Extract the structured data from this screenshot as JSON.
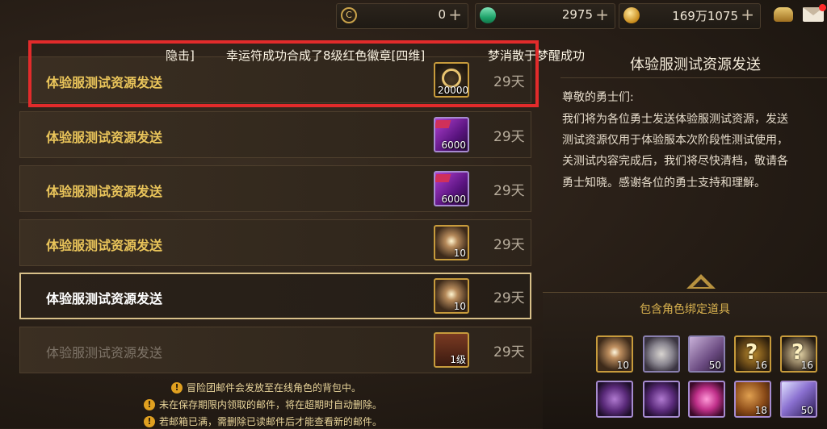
{
  "currency": {
    "c_points": {
      "icon": "c-coin-icon",
      "value": "0"
    },
    "gems": {
      "icon": "green-gem-icon",
      "value": "2975"
    },
    "gold": {
      "icon": "gold-coin-icon",
      "value": "169万1075"
    },
    "plus": "+"
  },
  "ticker": {
    "left_fragment": "隐击]",
    "main": "幸运符成功合成了8级红色徽章[四维]",
    "right_fragment": "梦消散于梦醒成功"
  },
  "mails": [
    {
      "title": "体验服测试资源发送",
      "days": "29天",
      "item_qty": "20000",
      "item": "c-coin-icon"
    },
    {
      "title": "体验服测试资源发送",
      "days": "29天",
      "item_qty": "6000",
      "item": "purple-currency-icon"
    },
    {
      "title": "体验服测试资源发送",
      "days": "29天",
      "item_qty": "6000",
      "item": "purple-currency-icon"
    },
    {
      "title": "体验服测试资源发送",
      "days": "29天",
      "item_qty": "10",
      "item": "starburst-icon"
    },
    {
      "title": "体验服测试资源发送",
      "days": "29天",
      "item_qty": "10",
      "item": "starburst-icon"
    },
    {
      "title": "体验服测试资源发送",
      "days": "29天",
      "item_qty": "1级",
      "item": "monster-card-icon"
    }
  ],
  "detail": {
    "title": "体验服测试资源发送",
    "greeting": "尊敬的勇士们:",
    "lines": [
      "我们将为各位勇士发送体验服测试资源，发送",
      "测试资源仅用于体验服本次阶段性测试使用，",
      "关测试内容完成后，我们将尽快清档，敬请各",
      "勇士知晓。感谢各位的勇士支持和理解。"
    ]
  },
  "items_panel": {
    "header": "包含角色绑定道具",
    "slots": [
      {
        "icon": "starburst-icon",
        "qty": "10"
      },
      {
        "icon": "silver-plate-icon",
        "qty": ""
      },
      {
        "icon": "treasure-box-icon",
        "qty": "50"
      },
      {
        "icon": "mystery-gold-icon",
        "qty": "16"
      },
      {
        "icon": "mystery-silver-icon",
        "qty": "16"
      },
      {
        "icon": "purple-emblem-icon",
        "qty": ""
      },
      {
        "icon": "purple-crown-icon",
        "qty": ""
      },
      {
        "icon": "pink-star-icon",
        "qty": ""
      },
      {
        "icon": "cookie-icon",
        "qty": "18"
      },
      {
        "icon": "crystal-ticket-icon",
        "qty": "50"
      }
    ]
  },
  "notices": [
    "冒险团邮件会发放至在线角色的背包中。",
    "未在保存期限内领取的邮件，将在超期时自动删除。",
    "若邮箱已满，需删除已读邮件后才能查看新的邮件。"
  ],
  "warn_glyph": "!"
}
